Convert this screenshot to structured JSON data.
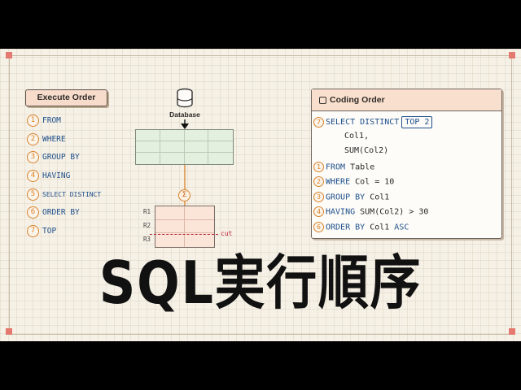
{
  "execute_order": {
    "title": "Execute Order",
    "items": [
      {
        "num": "1",
        "label": "FROM"
      },
      {
        "num": "2",
        "label": "WHERE"
      },
      {
        "num": "3",
        "label": "GROUP BY"
      },
      {
        "num": "4",
        "label": "HAVING"
      },
      {
        "num": "5",
        "label": "SELECT DISTINCT"
      },
      {
        "num": "6",
        "label": "ORDER BY"
      },
      {
        "num": "7",
        "label": "TOP"
      }
    ]
  },
  "diagram": {
    "database_label": "Database",
    "sigma_symbol": "Σ",
    "rows": [
      "R1",
      "R2",
      "R3"
    ],
    "cut_label": "cut"
  },
  "coding_order": {
    "title": "Coding Order",
    "lines": {
      "l1": {
        "num": "7",
        "kw": "SELECT DISTINCT",
        "box": "TOP 2"
      },
      "l2": {
        "text": "Col1,"
      },
      "l3": {
        "text": "SUM(Col2)"
      },
      "l4": {
        "num": "1",
        "kw": "FROM",
        "text": " Table"
      },
      "l5": {
        "num": "2",
        "kw": "WHERE",
        "text": " Col = 10"
      },
      "l6": {
        "num": "3",
        "kw": "GROUP BY",
        "text": " Col1"
      },
      "l7": {
        "num": "4",
        "kw": "HAVING",
        "text": " SUM(Col2) > 30"
      },
      "l8": {
        "num": "6",
        "kw": "ORDER BY",
        "text": " Col1 ",
        "kw2": "ASC"
      }
    }
  },
  "big_title": "SQL実行順序",
  "colors": {
    "accent_orange": "#d9822b",
    "keyword_blue": "#1e4f8a",
    "cut_red": "#c0263a",
    "corner_red": "#e47a6f"
  }
}
